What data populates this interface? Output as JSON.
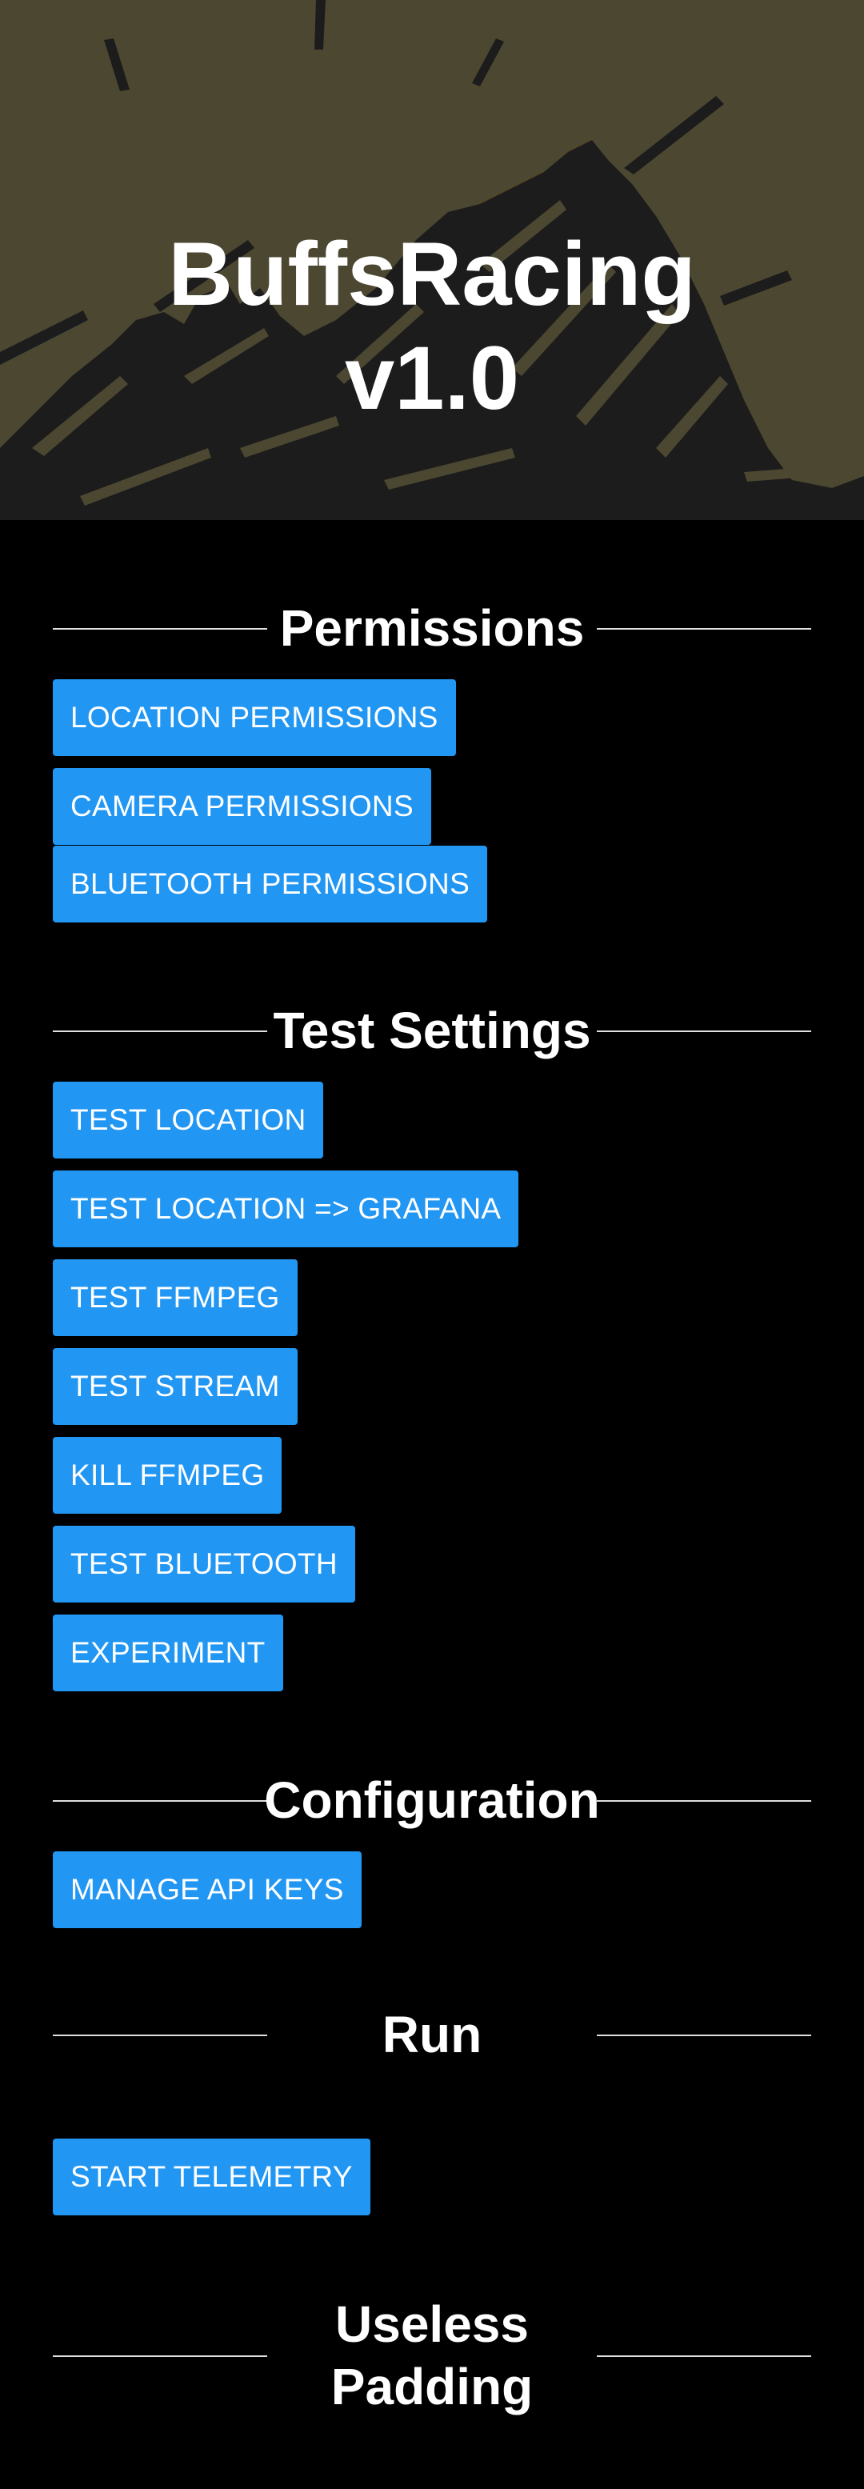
{
  "app": {
    "title_line1": "BuffsRacing",
    "title_line2": "v1.0"
  },
  "colors": {
    "banner_bg": "#4c4731",
    "banner_art": "#1c1c1c",
    "button_bg": "#2196f3",
    "page_bg": "#000000"
  },
  "sections": {
    "permissions": {
      "title": "Permissions",
      "buttons": {
        "location": "LOCATION PERMISSIONS",
        "camera": "CAMERA PERMISSIONS",
        "bluetooth": "BLUETOOTH PERMISSIONS"
      }
    },
    "test_settings": {
      "title": "Test Settings",
      "buttons": {
        "test_location": "TEST LOCATION",
        "test_location_grafana": "TEST LOCATION => GRAFANA",
        "test_ffmpeg": "TEST FFMPEG",
        "test_stream": "TEST STREAM",
        "kill_ffmpeg": "KILL FFMPEG",
        "test_bluetooth": "TEST BLUETOOTH",
        "experiment": "EXPERIMENT"
      }
    },
    "configuration": {
      "title": "Configuration",
      "buttons": {
        "manage_api_keys": "MANAGE API KEYS"
      }
    },
    "run": {
      "title": "Run",
      "buttons": {
        "start_telemetry": "START TELEMETRY"
      }
    },
    "useless_padding": {
      "title_line1": "Useless",
      "title_line2": "Padding"
    }
  }
}
